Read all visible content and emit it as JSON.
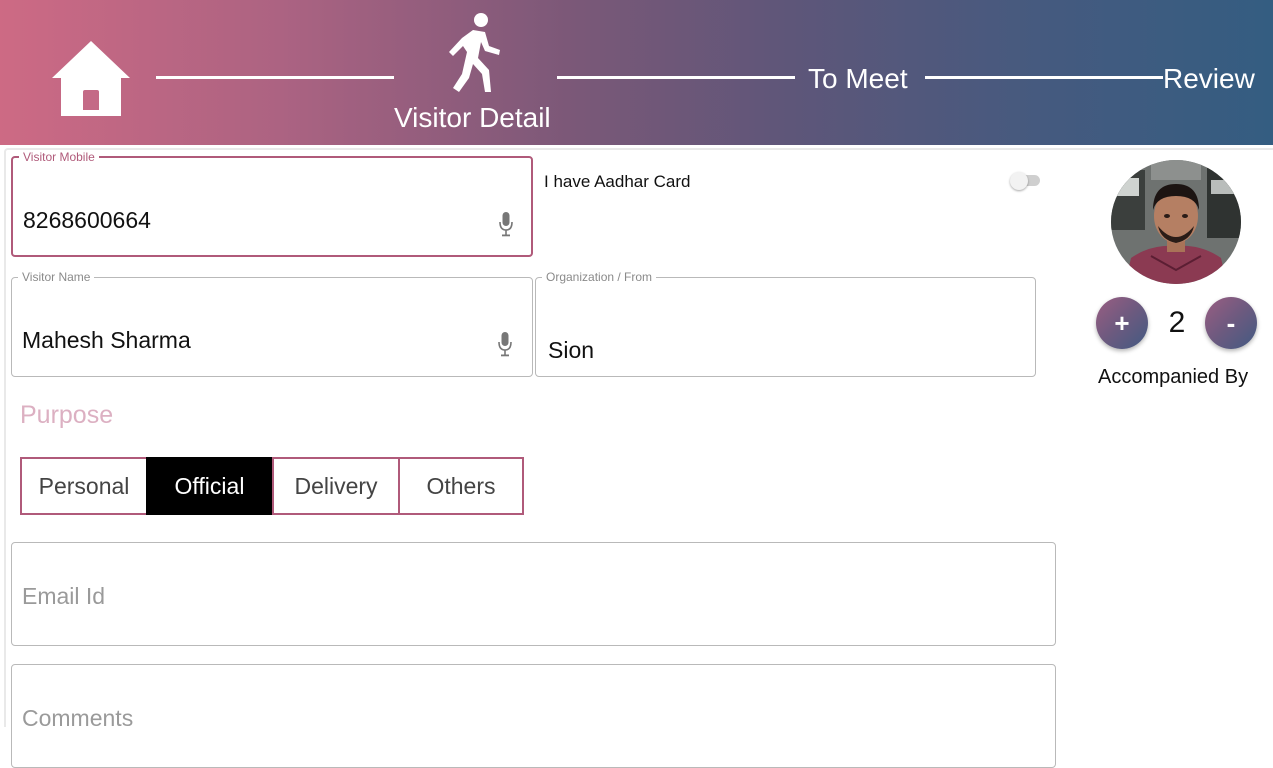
{
  "header": {
    "steps": [
      {
        "label": "",
        "icon": "home-icon"
      },
      {
        "label": "Visitor Detail",
        "icon": "walking-person-icon"
      },
      {
        "label": "To Meet"
      },
      {
        "label": "Review"
      }
    ],
    "gradient_colors": [
      "#cd6a84",
      "#345d81"
    ]
  },
  "form": {
    "mobile": {
      "label": "Visitor Mobile",
      "value": "8268600664"
    },
    "aadhar": {
      "label": "I have Aadhar Card",
      "checked": false
    },
    "name": {
      "label": "Visitor Name",
      "value": "Mahesh Sharma"
    },
    "organization": {
      "label": "Organization / From",
      "value": "Sion"
    },
    "purpose": {
      "title": "Purpose",
      "options": [
        "Personal",
        "Official",
        "Delivery",
        "Others"
      ],
      "selected": "Official"
    },
    "email": {
      "placeholder": "Email Id",
      "value": ""
    },
    "comments": {
      "placeholder": "Comments",
      "value": ""
    }
  },
  "side": {
    "plus_label": "+",
    "minus_label": "-",
    "count": "2",
    "accompanied_label": "Accompanied By"
  },
  "colors": {
    "accent": "#b05a7a",
    "selected": "#000000",
    "purpose_title": "#dcb0c2"
  }
}
